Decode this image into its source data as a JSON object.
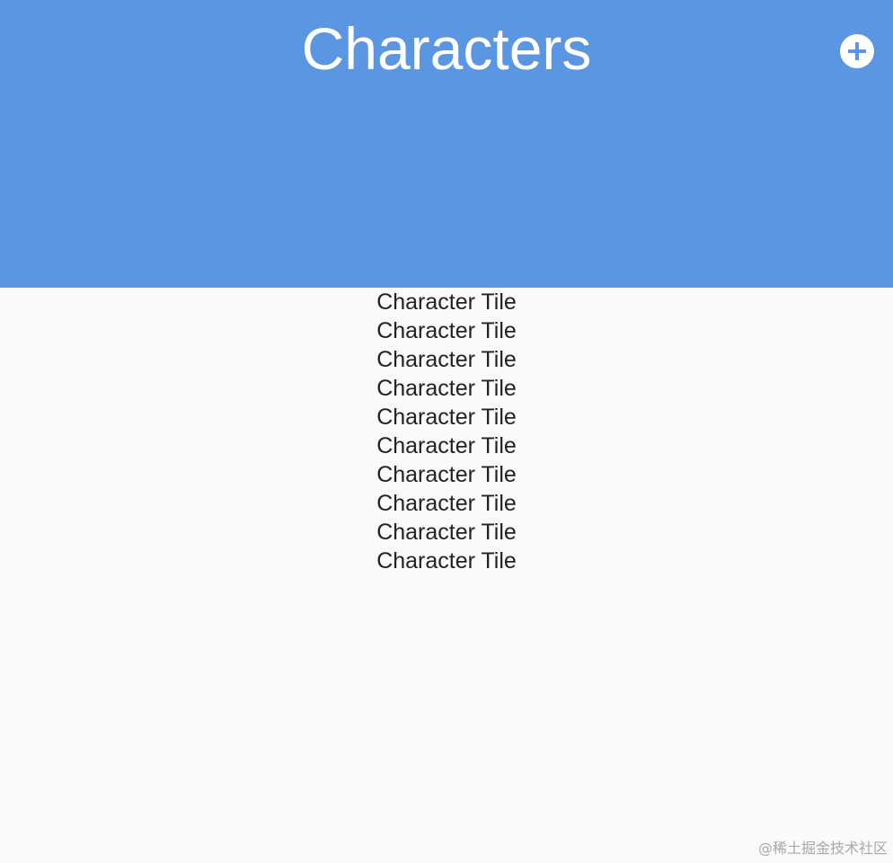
{
  "app_bar": {
    "title": "Characters",
    "add_icon": "add-circle-icon",
    "background_color": "#5b96e3"
  },
  "list": {
    "items": [
      {
        "label": "Character Tile"
      },
      {
        "label": "Character Tile"
      },
      {
        "label": "Character Tile"
      },
      {
        "label": "Character Tile"
      },
      {
        "label": "Character Tile"
      },
      {
        "label": "Character Tile"
      },
      {
        "label": "Character Tile"
      },
      {
        "label": "Character Tile"
      },
      {
        "label": "Character Tile"
      },
      {
        "label": "Character Tile"
      }
    ]
  },
  "watermark": "@稀土掘金技术社区"
}
